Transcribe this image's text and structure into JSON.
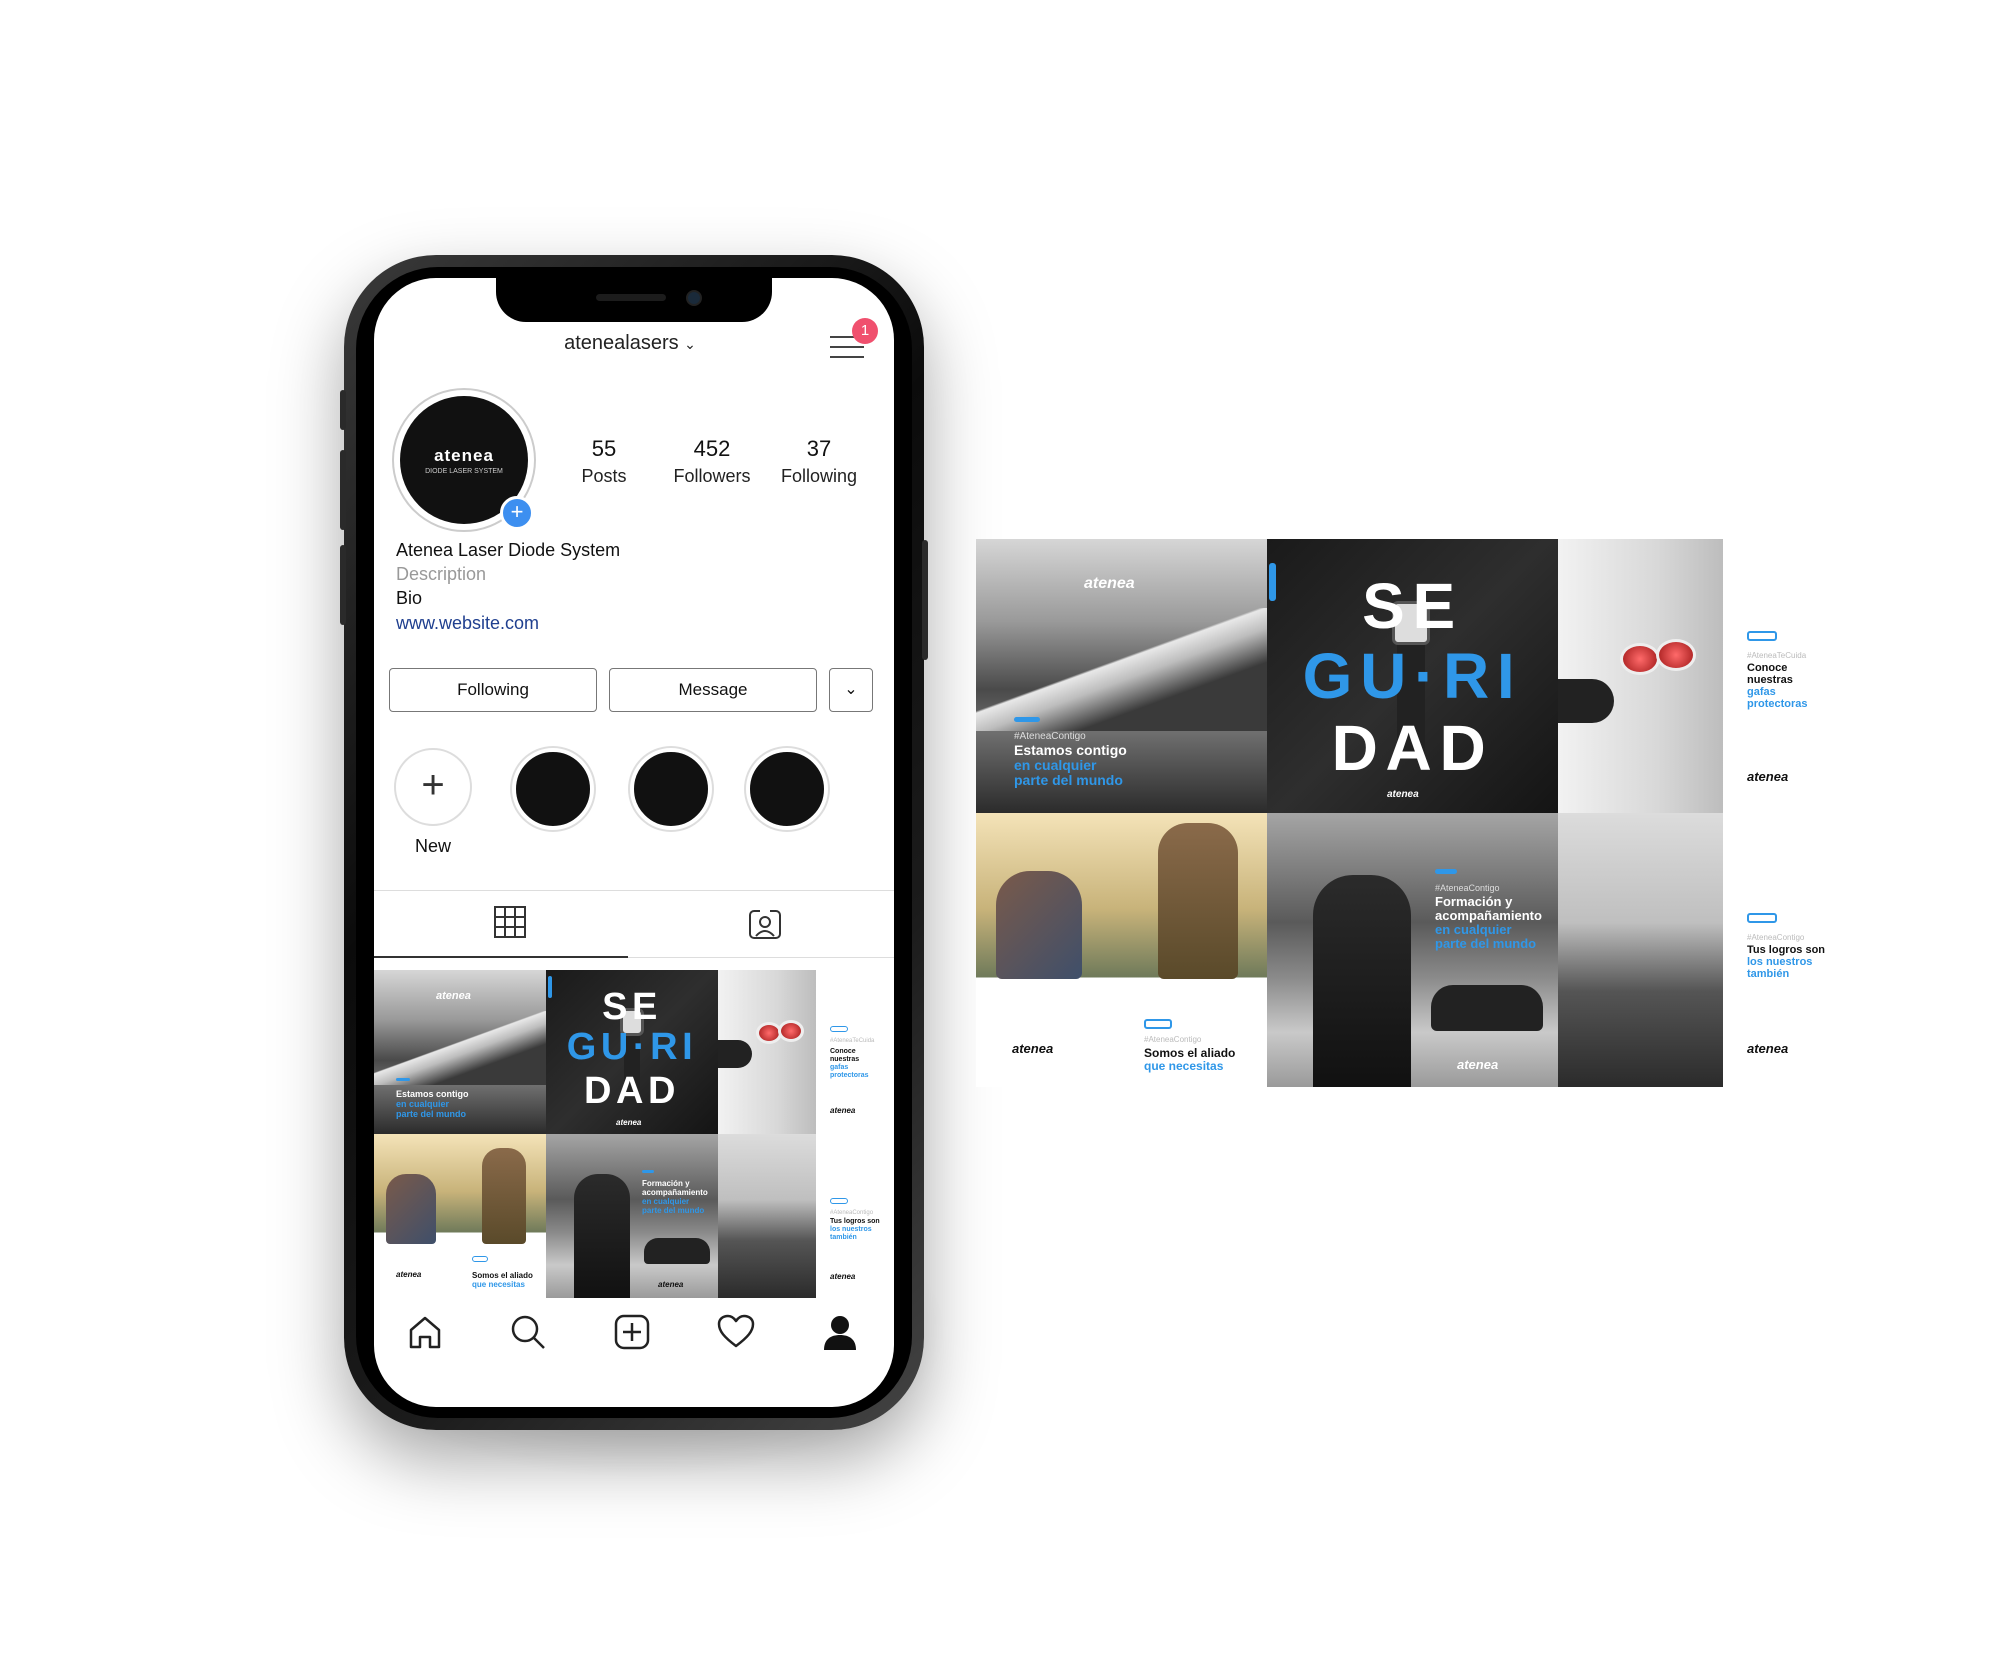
{
  "profile": {
    "username": "atenealasers",
    "notification_count": "1",
    "avatar_logo": "atenea",
    "avatar_sub": "DIODE LASER SYSTEM",
    "stats": [
      {
        "value": "55",
        "label": "Posts"
      },
      {
        "value": "452",
        "label": "Followers"
      },
      {
        "value": "37",
        "label": "Following"
      }
    ],
    "name": "Atenea Laser Diode System",
    "description": "Description",
    "bio": "Bio",
    "website": "www.website.com"
  },
  "actions": {
    "following": "Following",
    "message": "Message"
  },
  "highlights": {
    "new_label": "New"
  },
  "posts": {
    "brand": "atenea",
    "seguridad": [
      "SE",
      "GU·RI",
      "DAD"
    ],
    "p1": {
      "hash": "#AteneaContigo",
      "line1": "Estamos contigo",
      "line2": "en cualquier",
      "line3": "parte del mundo"
    },
    "p3": {
      "hash": "#AteneaTeCuida",
      "line1": "Conoce",
      "line2": "nuestras",
      "line3": "gafas",
      "line4": "protectoras"
    },
    "p4": {
      "hash": "#AteneaContigo",
      "line1": "Somos el aliado",
      "line2": "que necesitas"
    },
    "p5": {
      "hash": "#AteneaContigo",
      "line1": "Formación y",
      "line2": "acompañamiento",
      "line3": "en cualquier",
      "line4": "parte del mundo"
    },
    "p6": {
      "hash": "#AteneaContigo",
      "line1": "Tus logros son",
      "line2": "los nuestros",
      "line3": "también"
    }
  },
  "colors": {
    "accent_blue": "#2f97e8",
    "notification_red": "#f0506e",
    "avatar_plus_blue": "#3d8ff0",
    "link_blue": "#1f3f8f"
  },
  "icons": {
    "nav": [
      "home-icon",
      "search-icon",
      "add-post-icon",
      "heart-icon",
      "profile-icon"
    ],
    "tabs": [
      "grid-icon",
      "tagged-icon"
    ]
  }
}
